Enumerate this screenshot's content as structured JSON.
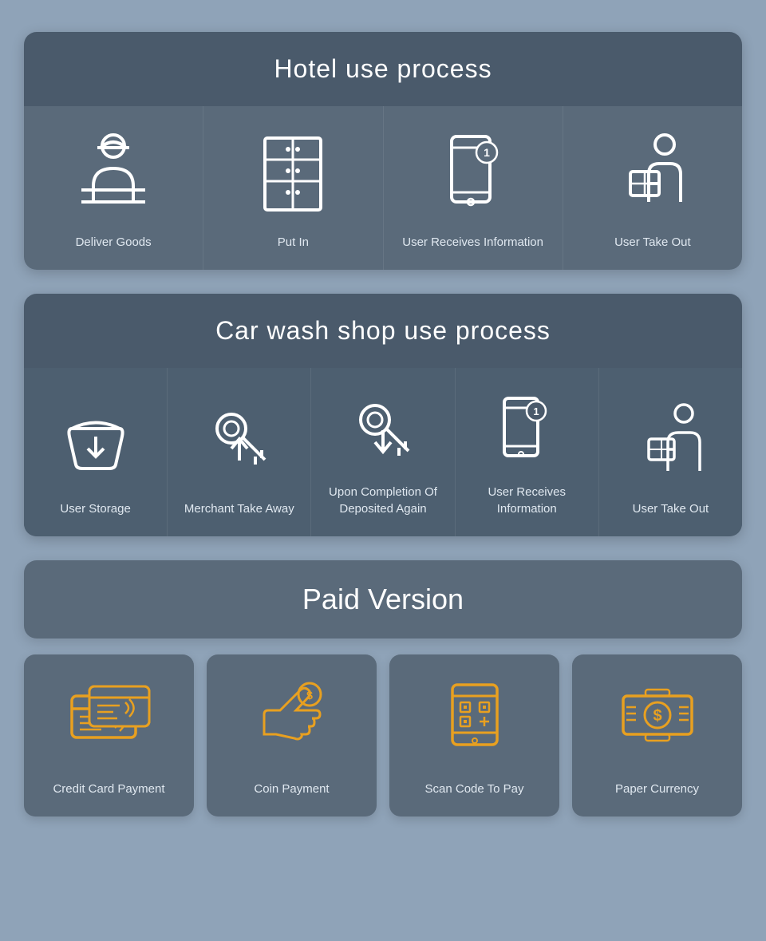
{
  "hotel": {
    "title": "Hotel use process",
    "items": [
      {
        "label": "Deliver Goods"
      },
      {
        "label": "Put In"
      },
      {
        "label": "User Receives Information"
      },
      {
        "label": "User Take Out"
      }
    ]
  },
  "carwash": {
    "title": "Car wash shop use process",
    "items": [
      {
        "label": "User Storage"
      },
      {
        "label": "Merchant Take Away"
      },
      {
        "label": "Upon Completion Of Deposited Again"
      },
      {
        "label": "User Receives Information"
      },
      {
        "label": "User Take Out"
      }
    ]
  },
  "paid": {
    "title": "Paid Version",
    "items": [
      {
        "label": "Credit Card Payment"
      },
      {
        "label": "Coin Payment"
      },
      {
        "label": "Scan Code To Pay"
      },
      {
        "label": "Paper Currency"
      }
    ]
  },
  "badge": "1"
}
